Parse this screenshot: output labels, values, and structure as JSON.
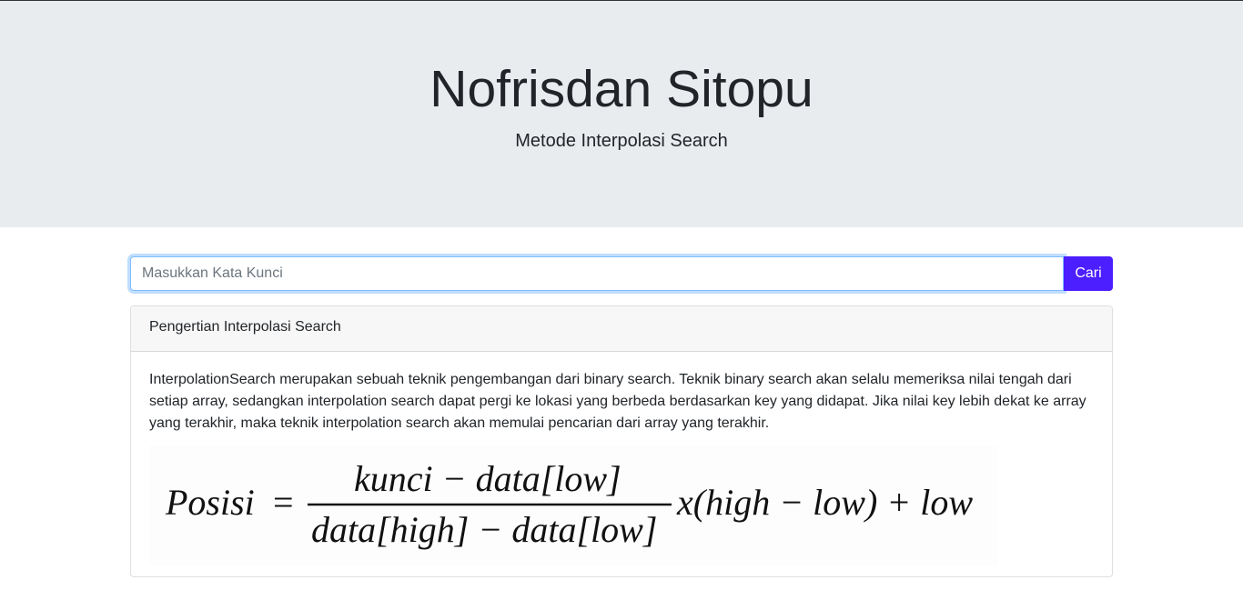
{
  "header": {
    "title": "Nofrisdan Sitopu",
    "subtitle": "Metode Interpolasi Search"
  },
  "search": {
    "placeholder": "Masukkan Kata Kunci",
    "value": "",
    "button_label": "Cari"
  },
  "card": {
    "header": "Pengertian Interpolasi Search",
    "text": "InterpolationSearch merupakan sebuah teknik pengembangan dari binary search. Teknik binary search akan selalu memeriksa nilai tengah dari setiap array, sedangkan interpolation search dapat pergi ke lokasi yang berbeda berdasarkan key yang didapat. Jika nilai key lebih dekat ke array yang terakhir, maka teknik interpolation search akan memulai pencarian dari array yang terakhir.",
    "formula": {
      "lhs": "Posisi",
      "equals": "=",
      "numerator": "kunci − data[low]",
      "denominator": "data[high] − data[low]",
      "rhs": "x(high − low) + low"
    }
  }
}
